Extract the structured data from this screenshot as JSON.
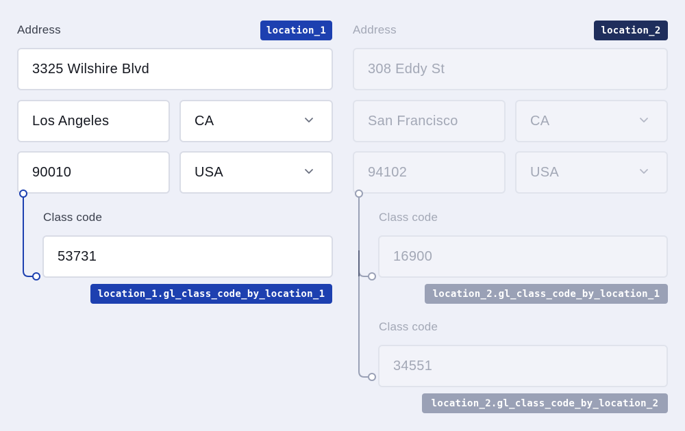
{
  "colors": {
    "background": "#eef0f8",
    "accent_blue": "#1d40b0",
    "accent_navy": "#1f2e5c",
    "muted_grey": "#9aa1b6"
  },
  "location_1": {
    "address_label": "Address",
    "tag": "location_1",
    "street": "3325 Wilshire Blvd",
    "city": "Los Angeles",
    "state": "CA",
    "zip": "90010",
    "country": "USA",
    "class_codes": [
      {
        "label": "Class code",
        "value": "53731",
        "tag": "location_1.gl_class_code_by_location_1"
      }
    ]
  },
  "location_2": {
    "address_label": "Address",
    "tag": "location_2",
    "street": "308 Eddy St",
    "city": "San Francisco",
    "state": "CA",
    "zip": "94102",
    "country": "USA",
    "class_codes": [
      {
        "label": "Class code",
        "value": "16900",
        "tag": "location_2.gl_class_code_by_location_1"
      },
      {
        "label": "Class code",
        "value": "34551",
        "tag": "location_2.gl_class_code_by_location_2"
      }
    ]
  },
  "icons": {
    "select_chevron": "chevron-down-icon",
    "connector_dot": "connector-node-icon"
  }
}
